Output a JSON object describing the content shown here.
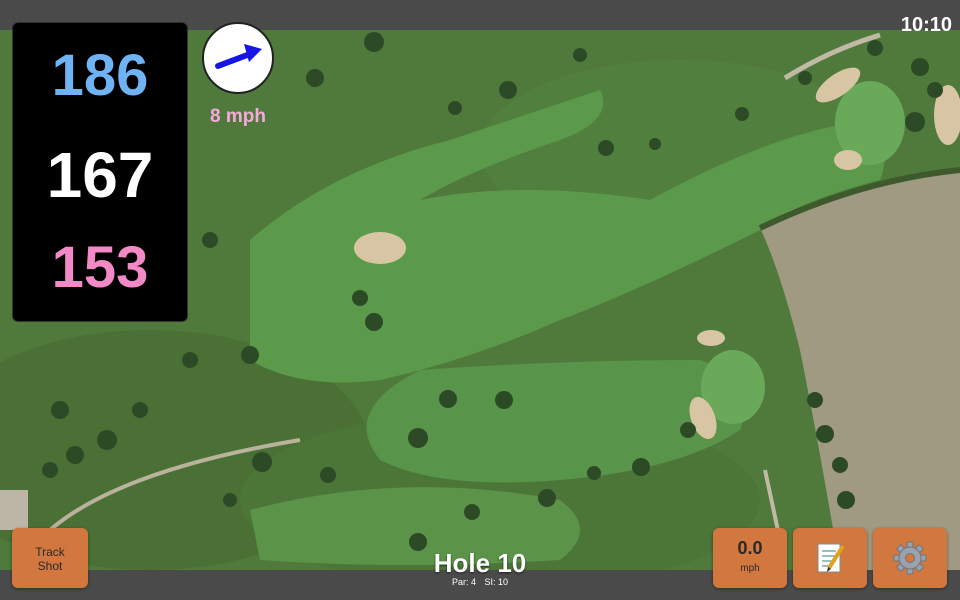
{
  "status": {
    "time": "10:10"
  },
  "yardages": {
    "back": "186",
    "middle": "167",
    "front": "153"
  },
  "wind": {
    "speed": "8 mph",
    "icon": "wind-direction-arrow-icon"
  },
  "hole": {
    "title": "Hole 10",
    "par": "Par: 4",
    "si": "SI: 10"
  },
  "buttons": {
    "track_shot_line1": "Track",
    "track_shot_line2": "Shot",
    "speed_value": "0.0",
    "speed_unit": "mph",
    "notes_icon": "notepad-icon",
    "settings_icon": "gear-icon"
  },
  "colors": {
    "back_yardage": "#6fb3f5",
    "middle_yardage": "#ffffff",
    "front_yardage": "#f389c6",
    "wind_speed": "#f7a9dc",
    "button": "#d2773e"
  }
}
